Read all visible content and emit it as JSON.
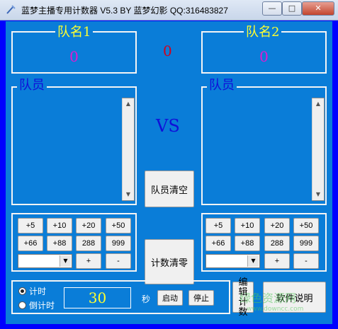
{
  "window": {
    "title": "蓝梦主播专用计数器 V5.3 BY 蓝梦幻影 QQ:316483827"
  },
  "team1": {
    "name": "队名1",
    "score": "0",
    "members_label": "队员"
  },
  "team2": {
    "name": "队名2",
    "score": "0",
    "members_label": "队员"
  },
  "center": {
    "score": "0",
    "vs": "VS",
    "clear_members_label": "队员清空",
    "reset_count_label": "计数清零"
  },
  "buttons_left": {
    "row1": [
      "+5",
      "+10",
      "+20",
      "+50"
    ],
    "row2": [
      "+66",
      "+88",
      "288",
      "999"
    ],
    "plus": "+",
    "minus": "-"
  },
  "buttons_right": {
    "row1": [
      "+5",
      "+10",
      "+20",
      "+50"
    ],
    "row2": [
      "+66",
      "+88",
      "288",
      "999"
    ],
    "plus": "+",
    "minus": "-"
  },
  "timer": {
    "count_up_label": "计时",
    "count_down_label": "倒计时",
    "selected": "count_up",
    "value": "30",
    "unit": "秒",
    "start_label": "启动",
    "stop_label": "停止"
  },
  "edit_count_label": "编辑计数",
  "software_info_label": "软件说明",
  "watermark": {
    "text": "绿色资源网",
    "url": "www.downcc.com"
  },
  "colors": {
    "client_bg": "#0a7dd8",
    "team_name": "#ffff30",
    "team_label_blue": "#1010d8",
    "score_pink": "#e01ad0",
    "center_score": "#d2001c",
    "timer_yellow": "#ffff30"
  }
}
